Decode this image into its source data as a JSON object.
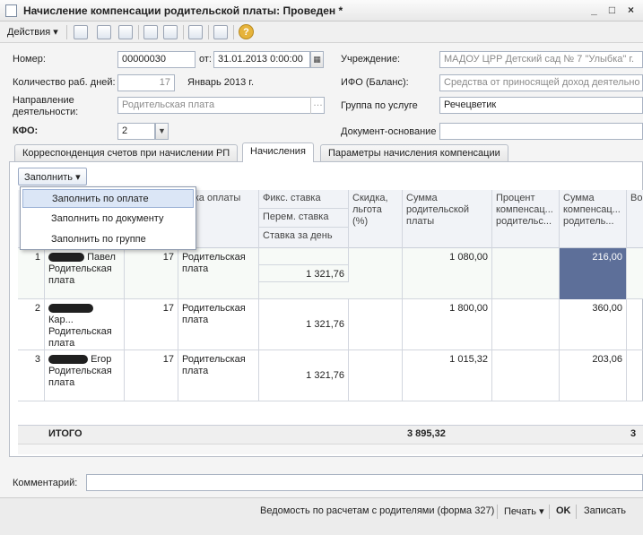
{
  "window": {
    "title": "Начисление компенсации родительской платы: Проведен *",
    "controls": [
      "_",
      "□",
      "×"
    ]
  },
  "toolbar": {
    "actions_label": "Действия",
    "help_glyph": "?"
  },
  "header": {
    "number_label": "Номер:",
    "number_value": "00000030",
    "from_label": "от:",
    "date_value": "31.01.2013  0:00:00",
    "institution_label": "Учреждение:",
    "institution_value": "МАДОУ ЦРР Детский сад № 7 \"Улыбка\" г.",
    "workdays_label": "Количество раб. дней:",
    "workdays_value": "17",
    "period_text": "Январь 2013 г.",
    "ifo_label": "ИФО (Баланс):",
    "ifo_value": "Средства от приносящей доход деятельно",
    "direction_label_1": "Направление",
    "direction_label_2": "деятельности:",
    "direction_value": "Родительская плата",
    "service_group_label": "Группа по услуге",
    "service_group_value": "Речецветик",
    "kfo_label": "КФО:",
    "kfo_value": "2",
    "basis_label": "Документ-основание"
  },
  "tabs": [
    {
      "label": "Корреспонденция счетов при начислении РП"
    },
    {
      "label": "Начисления"
    },
    {
      "label": "Параметры начисления компенсации"
    }
  ],
  "fill_button": {
    "label": "Заполнить"
  },
  "fill_menu": [
    {
      "label": "Заполнить по оплате"
    },
    {
      "label": "Заполнить по документу"
    },
    {
      "label": "Заполнить по группе"
    }
  ],
  "table": {
    "headers": {
      "payment_type": "Вид оплаты",
      "payment_type_visible": "ывка оплаты",
      "fixed_rate": "Фикс. ставка",
      "var_rate": "Перем. ставка",
      "day_rate": "Ставка за день",
      "discount": "Скидка, льгота (%)",
      "parent_sum": "Сумма родительской платы",
      "comp_percent": "Процент компенсац... родительс...",
      "comp_sum": "Сумма компенсац... родитель...",
      "extra": "Во"
    },
    "rows": [
      {
        "n": "1",
        "name": "Павел",
        "kind": "Родительская плата",
        "days": "17",
        "payment": "Родительская плата",
        "day_rate": "1 321,76",
        "parent_sum": "1 080,00",
        "comp_sum": "216,00"
      },
      {
        "n": "2",
        "name": "Кар...",
        "kind": "Родительская плата",
        "days": "17",
        "payment": "Родительская плата",
        "day_rate": "1 321,76",
        "parent_sum": "1 800,00",
        "comp_sum": "360,00"
      },
      {
        "n": "3",
        "name": "Егор",
        "kind": "Родительская плата",
        "days": "17",
        "payment": "Родительская плата",
        "day_rate": "1 321,76",
        "parent_sum": "1 015,32",
        "comp_sum": "203,06"
      }
    ],
    "totals": {
      "label": "ИТОГО",
      "parent_sum": "3 895,32",
      "extra": "3"
    }
  },
  "comment": {
    "label": "Комментарий:",
    "value": ""
  },
  "footer": {
    "report_label": "Ведомость по расчетам с родителями (форма 327)",
    "print_label": "Печать",
    "ok_label": "OK",
    "save_label": "Записать"
  },
  "colors": {
    "selected_cell": "#5d6f99",
    "accent": "#9cb2d6"
  }
}
